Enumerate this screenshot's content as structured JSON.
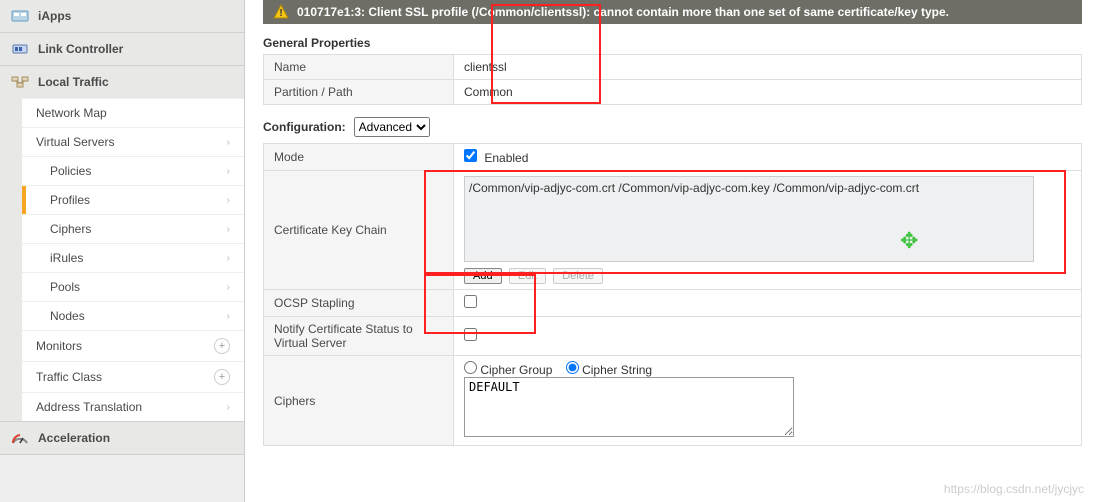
{
  "sidebar": {
    "iapps": "iApps",
    "linkcontroller": "Link Controller",
    "localtraffic": "Local Traffic",
    "lt_items": [
      {
        "label": "Network Map",
        "chev": "",
        "level": 1,
        "active": false
      },
      {
        "label": "Virtual Servers",
        "chev": "›",
        "level": 1,
        "active": false
      },
      {
        "label": "Policies",
        "chev": "›",
        "level": 2,
        "active": false
      },
      {
        "label": "Profiles",
        "chev": "›",
        "level": 2,
        "active": true
      },
      {
        "label": "Ciphers",
        "chev": "›",
        "level": 2,
        "active": false
      },
      {
        "label": "iRules",
        "chev": "›",
        "level": 2,
        "active": false
      },
      {
        "label": "Pools",
        "chev": "›",
        "level": 2,
        "active": false
      },
      {
        "label": "Nodes",
        "chev": "›",
        "level": 2,
        "active": false
      }
    ],
    "monitors": "Monitors",
    "trafficclass": "Traffic Class",
    "addrtrans": "Address Translation",
    "acceleration": "Acceleration"
  },
  "alert": {
    "text": "010717e1:3: Client SSL profile (/Common/clientssl): cannot contain more than one set of same certificate/key type."
  },
  "general": {
    "title": "General Properties",
    "name_label": "Name",
    "name_value": "clientssl",
    "partition_label": "Partition / Path",
    "partition_value": "Common"
  },
  "config": {
    "label": "Configuration:",
    "selected": "Advanced",
    "mode_label": "Mode",
    "mode_enabled": "Enabled",
    "ckc_label": "Certificate Key Chain",
    "ckc_entry": "/Common/vip-adjyc-com.crt /Common/vip-adjyc-com.key /Common/vip-adjyc-com.crt",
    "btn_add": "Add",
    "btn_edit": "Edit",
    "btn_delete": "Delete",
    "ocsp_label": "OCSP Stapling",
    "notify_label": "Notify Certificate Status to Virtual Server",
    "ciphers_label": "Ciphers",
    "radio_group": "Cipher Group",
    "radio_string": "Cipher String",
    "cipher_text": "DEFAULT"
  },
  "watermark": "https://blog.csdn.net/jycjyc"
}
